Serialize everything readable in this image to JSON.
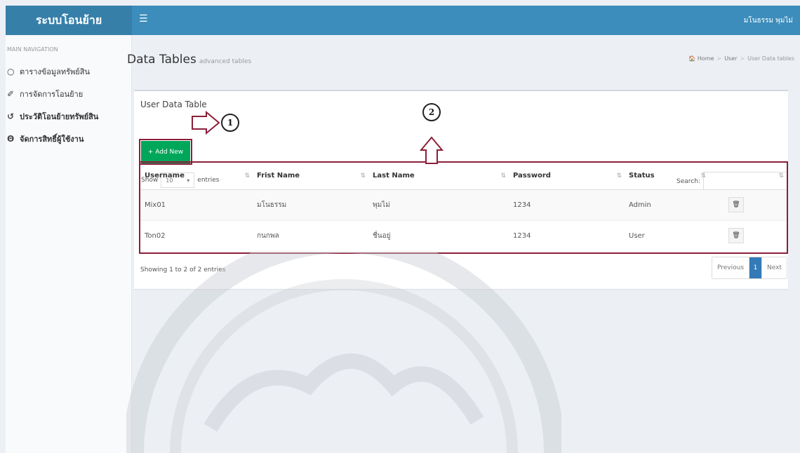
{
  "app": {
    "logo": "ระบบโอนย้าย",
    "user": "มโนธรรม พุมไม่",
    "menu_icon": "hamburger-icon"
  },
  "sidebar": {
    "header": "MAIN NAVIGATION",
    "items": [
      {
        "icon": "circle-icon",
        "label": "ตารางข้อมูลทรัพย์สิน"
      },
      {
        "icon": "edit-icon",
        "label": "การจัดการโอนย้าย"
      },
      {
        "icon": "history-icon",
        "label": "ประวัติโอนย้ายทรัพย์สิน"
      },
      {
        "icon": "user-icon",
        "label": "จัดการสิทธิ์ผู้ใช้งาน"
      }
    ]
  },
  "page": {
    "title": "Data Tables",
    "subtitle": "advanced tables",
    "breadcrumb": [
      "Home",
      "User",
      "User Data tables"
    ]
  },
  "box": {
    "title": "User Data Table",
    "add_label": "+ Add New",
    "show_label": "Show",
    "length_value": "10",
    "entries_label": "entries",
    "search_label": "Search:"
  },
  "table": {
    "headers": [
      "Username",
      "Frist Name",
      "Last Name",
      "Password",
      "Status",
      ""
    ],
    "rows": [
      {
        "username": "Mix01",
        "first": "มโนธรรม",
        "last": "พุมไม่",
        "password": "1234",
        "status": "Admin"
      },
      {
        "username": "Ton02",
        "first": "กนกพล",
        "last": "ชื่นอยู่",
        "password": "1234",
        "status": "User"
      }
    ]
  },
  "footer": {
    "info": "Showing 1 to 2 of 2 entries",
    "prev": "Previous",
    "page": "1",
    "next": "Next"
  },
  "annotations": {
    "one": "1",
    "two": "2"
  },
  "colors": {
    "header": "#3c8dbc",
    "logo_bg": "#367fa9",
    "add_button": "#00a65a",
    "annotation_frame": "#8b1f3a",
    "pager_active": "#337ab7"
  }
}
